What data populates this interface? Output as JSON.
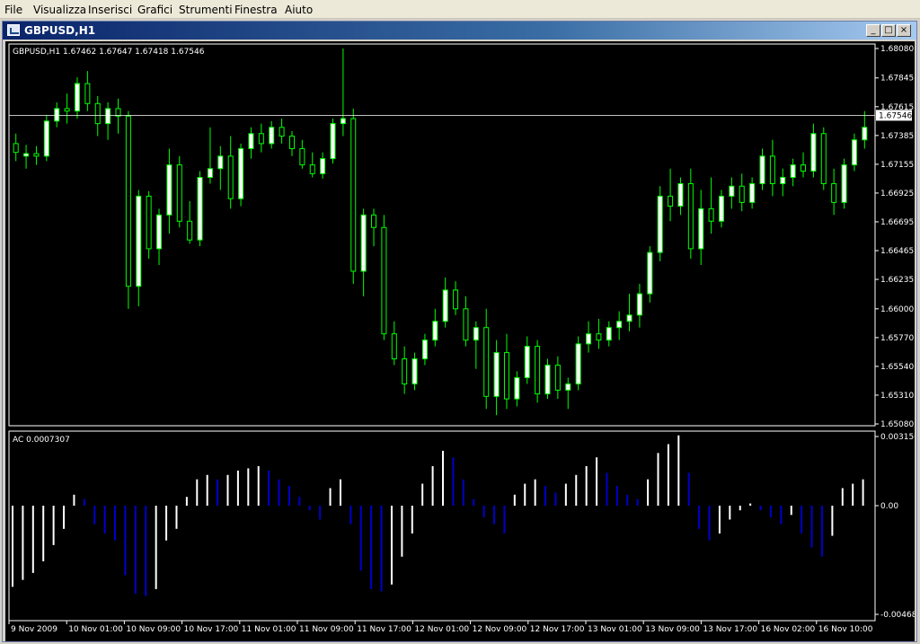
{
  "menu": [
    "File",
    "Visualizza",
    "Inserisci",
    "Grafici",
    "Strumenti",
    "Finestra",
    "Aiuto"
  ],
  "window": {
    "title": "GBPUSD,H1",
    "min": "_",
    "max": "□",
    "close": "×"
  },
  "chart_header": "GBPUSD,H1  1.67462 1.67647 1.67418 1.67546",
  "indicator_header": "AC 0.0007307",
  "current_price": "1.67546",
  "colors": {
    "bull": "#ffffff",
    "bear": "#000000",
    "wick": "#00ff00",
    "up_bar": "#ffffff",
    "down_bar": "#0000cc",
    "grid_line": "#ffffff"
  },
  "chart_data": {
    "type": "candlestick",
    "price_ticks": [
      "1.68080",
      "1.67845",
      "1.67615",
      "1.67385",
      "1.67155",
      "1.66925",
      "1.66695",
      "1.66465",
      "1.66235",
      "1.66000",
      "1.65770",
      "1.65540",
      "1.65310",
      "1.65080"
    ],
    "price_range": [
      1.6508,
      1.6808
    ],
    "indicator_ticks": [
      "0.003150",
      "0.00",
      "-0.004689"
    ],
    "indicator_range": [
      -0.004689,
      0.00315
    ],
    "time_labels": [
      "9 Nov 2009",
      "10 Nov 01:00",
      "10 Nov 09:00",
      "10 Nov 17:00",
      "11 Nov 01:00",
      "11 Nov 09:00",
      "11 Nov 17:00",
      "12 Nov 01:00",
      "12 Nov 09:00",
      "12 Nov 17:00",
      "13 Nov 01:00",
      "13 Nov 09:00",
      "13 Nov 17:00",
      "16 Nov 02:00",
      "16 Nov 10:00"
    ],
    "candles": [
      [
        1.6732,
        1.674,
        1.6718,
        1.6725
      ],
      [
        1.6722,
        1.6731,
        1.6712,
        1.6724
      ],
      [
        1.6724,
        1.673,
        1.6715,
        1.6722
      ],
      [
        1.6722,
        1.6755,
        1.6718,
        1.675
      ],
      [
        1.675,
        1.6765,
        1.6745,
        1.676
      ],
      [
        1.676,
        1.6772,
        1.6748,
        1.6758
      ],
      [
        1.6758,
        1.6785,
        1.6752,
        1.678
      ],
      [
        1.678,
        1.679,
        1.6758,
        1.6764
      ],
      [
        1.6764,
        1.677,
        1.6738,
        1.6748
      ],
      [
        1.6748,
        1.6765,
        1.6735,
        1.676
      ],
      [
        1.676,
        1.6768,
        1.674,
        1.6754
      ],
      [
        1.6754,
        1.6758,
        1.66,
        1.6618
      ],
      [
        1.6618,
        1.6695,
        1.6602,
        1.669
      ],
      [
        1.669,
        1.6694,
        1.664,
        1.6648
      ],
      [
        1.6648,
        1.668,
        1.6635,
        1.6675
      ],
      [
        1.6675,
        1.6728,
        1.666,
        1.6715
      ],
      [
        1.6715,
        1.6722,
        1.6665,
        1.667
      ],
      [
        1.667,
        1.6686,
        1.6652,
        1.6655
      ],
      [
        1.6655,
        1.671,
        1.665,
        1.6705
      ],
      [
        1.6705,
        1.6745,
        1.67,
        1.6712
      ],
      [
        1.6712,
        1.673,
        1.6695,
        1.6722
      ],
      [
        1.6722,
        1.6738,
        1.668,
        1.6688
      ],
      [
        1.6688,
        1.6732,
        1.6682,
        1.6728
      ],
      [
        1.6728,
        1.6745,
        1.672,
        1.674
      ],
      [
        1.674,
        1.6748,
        1.6725,
        1.6732
      ],
      [
        1.6732,
        1.675,
        1.6728,
        1.6745
      ],
      [
        1.6745,
        1.6752,
        1.6732,
        1.6738
      ],
      [
        1.6738,
        1.6742,
        1.6722,
        1.6728
      ],
      [
        1.6728,
        1.6735,
        1.6712,
        1.6715
      ],
      [
        1.6715,
        1.6725,
        1.6705,
        1.6708
      ],
      [
        1.6708,
        1.6725,
        1.6704,
        1.672
      ],
      [
        1.672,
        1.6752,
        1.6716,
        1.6748
      ],
      [
        1.6748,
        1.6808,
        1.6738,
        1.6752
      ],
      [
        1.6752,
        1.676,
        1.662,
        1.663
      ],
      [
        1.663,
        1.668,
        1.661,
        1.6675
      ],
      [
        1.6675,
        1.668,
        1.665,
        1.6665
      ],
      [
        1.6665,
        1.6675,
        1.6575,
        1.658
      ],
      [
        1.658,
        1.659,
        1.6555,
        1.656
      ],
      [
        1.656,
        1.657,
        1.6532,
        1.654
      ],
      [
        1.654,
        1.6565,
        1.6535,
        1.656
      ],
      [
        1.656,
        1.658,
        1.6555,
        1.6575
      ],
      [
        1.6575,
        1.66,
        1.657,
        1.659
      ],
      [
        1.659,
        1.6625,
        1.6585,
        1.6615
      ],
      [
        1.6615,
        1.6622,
        1.6595,
        1.66
      ],
      [
        1.66,
        1.661,
        1.657,
        1.6575
      ],
      [
        1.6575,
        1.659,
        1.6552,
        1.6585
      ],
      [
        1.6585,
        1.66,
        1.652,
        1.653
      ],
      [
        1.653,
        1.6575,
        1.6515,
        1.6565
      ],
      [
        1.6565,
        1.658,
        1.652,
        1.6528
      ],
      [
        1.6528,
        1.655,
        1.6522,
        1.6545
      ],
      [
        1.6545,
        1.6578,
        1.654,
        1.657
      ],
      [
        1.657,
        1.6575,
        1.6525,
        1.6532
      ],
      [
        1.6532,
        1.656,
        1.6528,
        1.6555
      ],
      [
        1.6555,
        1.6562,
        1.6528,
        1.6535
      ],
      [
        1.6535,
        1.6545,
        1.652,
        1.654
      ],
      [
        1.654,
        1.6578,
        1.6535,
        1.6572
      ],
      [
        1.6572,
        1.659,
        1.6565,
        1.658
      ],
      [
        1.658,
        1.6592,
        1.6568,
        1.6575
      ],
      [
        1.6575,
        1.659,
        1.657,
        1.6585
      ],
      [
        1.6585,
        1.6598,
        1.6575,
        1.659
      ],
      [
        1.659,
        1.6612,
        1.6582,
        1.6595
      ],
      [
        1.6595,
        1.662,
        1.6585,
        1.6612
      ],
      [
        1.6612,
        1.665,
        1.6605,
        1.6645
      ],
      [
        1.6645,
        1.6698,
        1.6638,
        1.669
      ],
      [
        1.669,
        1.6712,
        1.667,
        1.6682
      ],
      [
        1.6682,
        1.6705,
        1.6675,
        1.67
      ],
      [
        1.67,
        1.6712,
        1.664,
        1.6648
      ],
      [
        1.6648,
        1.6695,
        1.6635,
        1.668
      ],
      [
        1.668,
        1.6705,
        1.666,
        1.667
      ],
      [
        1.667,
        1.6695,
        1.6665,
        1.669
      ],
      [
        1.669,
        1.6705,
        1.668,
        1.6698
      ],
      [
        1.6698,
        1.6708,
        1.6678,
        1.6685
      ],
      [
        1.6685,
        1.6705,
        1.668,
        1.67
      ],
      [
        1.67,
        1.6728,
        1.6695,
        1.6722
      ],
      [
        1.6722,
        1.6735,
        1.669,
        1.67
      ],
      [
        1.67,
        1.6712,
        1.669,
        1.6705
      ],
      [
        1.6705,
        1.672,
        1.6698,
        1.6715
      ],
      [
        1.6715,
        1.6725,
        1.6705,
        1.671
      ],
      [
        1.671,
        1.6748,
        1.6705,
        1.674
      ],
      [
        1.674,
        1.6745,
        1.6695,
        1.67
      ],
      [
        1.67,
        1.6712,
        1.6675,
        1.6685
      ],
      [
        1.6685,
        1.672,
        1.668,
        1.6715
      ],
      [
        1.6715,
        1.674,
        1.671,
        1.6735
      ],
      [
        1.6735,
        1.6758,
        1.6728,
        1.6745
      ]
    ],
    "indicator": [
      -0.0035,
      -0.0032,
      -0.0029,
      -0.0024,
      -0.0017,
      -0.001,
      0.0005,
      0.0003,
      -0.0008,
      -0.0012,
      -0.0015,
      -0.003,
      -0.0038,
      -0.0039,
      -0.0036,
      -0.0015,
      -0.001,
      0.0004,
      0.0012,
      0.0014,
      0.0012,
      0.0014,
      0.0016,
      0.0017,
      0.0018,
      0.0016,
      0.0012,
      0.0009,
      0.0004,
      -0.0002,
      -0.0006,
      0.0008,
      0.0012,
      -0.0008,
      -0.0028,
      -0.0036,
      -0.0037,
      -0.0034,
      -0.0022,
      -0.0012,
      0.001,
      0.0018,
      0.0025,
      0.0022,
      0.0012,
      0.0003,
      -0.0005,
      -0.0008,
      -0.0012,
      0.0005,
      0.001,
      0.0012,
      0.0009,
      0.0006,
      0.001,
      0.0014,
      0.0018,
      0.0022,
      0.0015,
      0.0009,
      0.0005,
      0.0003,
      0.0012,
      0.0024,
      0.0028,
      0.0032,
      0.0015,
      -0.001,
      -0.0015,
      -0.0012,
      -0.0006,
      -0.0002,
      0.0001,
      -0.0002,
      -0.0005,
      -0.0008,
      -0.0004,
      -0.0012,
      -0.0018,
      -0.0022,
      -0.0013,
      0.0008,
      0.001,
      0.0012
    ]
  }
}
